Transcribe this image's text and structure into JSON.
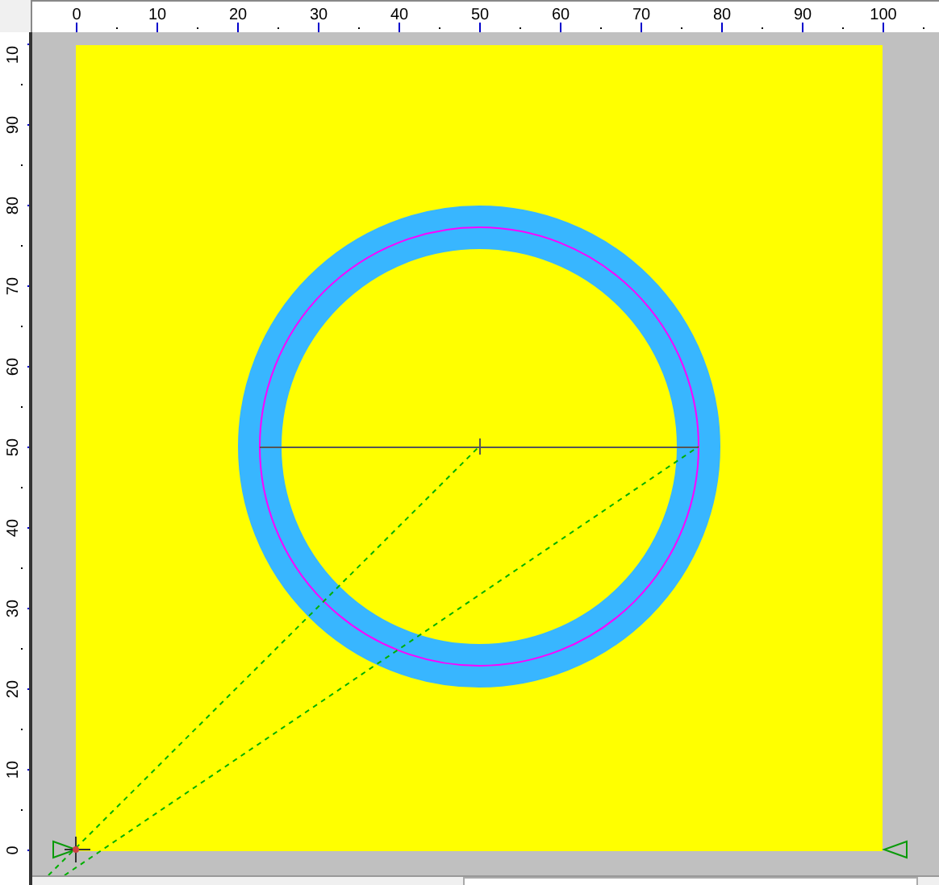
{
  "top_ruler": {
    "labels": [
      "0",
      "10",
      "20",
      "30",
      "40",
      "50",
      "60",
      "70",
      "80",
      "90",
      "100"
    ]
  },
  "left_ruler": {
    "labels": [
      "0",
      "10",
      "20",
      "30",
      "40",
      "50",
      "60",
      "70",
      "80",
      "90",
      "10"
    ]
  }
}
